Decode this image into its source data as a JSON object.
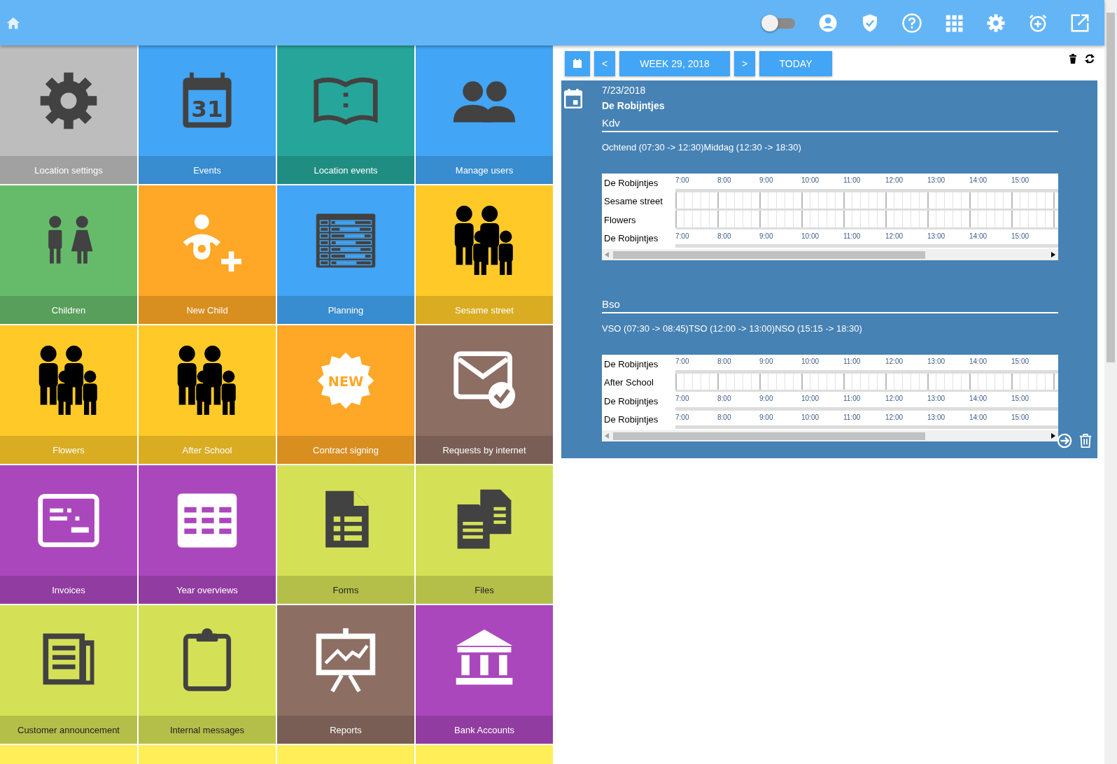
{
  "topbar": {
    "toggle": {
      "on": false
    }
  },
  "tiles": [
    {
      "label": "Location settings",
      "kind": "gear",
      "color": "#bdbdbd"
    },
    {
      "label": "Events",
      "kind": "calendar",
      "color": "#42a5f5",
      "badge": "31"
    },
    {
      "label": "Location events",
      "kind": "book",
      "color": "#26a69a"
    },
    {
      "label": "Manage users",
      "kind": "users",
      "color": "#42a5f5"
    },
    {
      "label": "Children",
      "kind": "children",
      "color": "#66bb6a"
    },
    {
      "label": "New Child",
      "kind": "baby",
      "color": "#ffa726"
    },
    {
      "label": "Planning",
      "kind": "planning",
      "color": "#42a5f5"
    },
    {
      "label": "Sesame street",
      "kind": "family",
      "color": "#ffca28"
    },
    {
      "label": "Flowers",
      "kind": "family",
      "color": "#ffca28"
    },
    {
      "label": "After School",
      "kind": "family",
      "color": "#ffca28"
    },
    {
      "label": "Contract signing",
      "kind": "new",
      "color": "#ffa726",
      "badge": "NEW"
    },
    {
      "label": "Requests by internet",
      "kind": "mail",
      "color": "#8d6e63"
    },
    {
      "label": "Invoices",
      "kind": "invoice",
      "color": "#ab47bc"
    },
    {
      "label": "Year overviews",
      "kind": "year",
      "color": "#ab47bc"
    },
    {
      "label": "Forms",
      "kind": "form",
      "color": "#d4e157"
    },
    {
      "label": "Files",
      "kind": "files",
      "color": "#d4e157"
    },
    {
      "label": "Customer announcement",
      "kind": "news",
      "color": "#d4e157"
    },
    {
      "label": "Internal messages",
      "kind": "clipboard",
      "color": "#d4e157"
    },
    {
      "label": "Reports",
      "kind": "chart",
      "color": "#8d6e63"
    },
    {
      "label": "Bank Accounts",
      "kind": "bank",
      "color": "#ab47bc"
    },
    {
      "kind": "blank",
      "color": "#ffee58"
    },
    {
      "kind": "blank",
      "color": "#ffee58"
    },
    {
      "kind": "blank",
      "color": "#ffee58"
    },
    {
      "kind": "blank",
      "color": "#ffee58"
    }
  ],
  "toolbar": {
    "week": "WEEK 29, 2018",
    "prev": "<",
    "next": ">",
    "today": "TODAY"
  },
  "day": {
    "date": "7/23/2018",
    "location": "De Robijntjes",
    "sections": [
      {
        "title": "Kdv",
        "shifts": "Ochtend (07:30 -> 12:30)Middag (12:30 -> 18:30)",
        "rows": [
          {
            "label": "De Robijntjes",
            "kind": "scale",
            "ticks": [
              "7:00",
              "8:00",
              "9:00",
              "10:00",
              "11:00",
              "12:00",
              "13:00",
              "14:00",
              "15:00"
            ]
          },
          {
            "label": "Sesame street",
            "kind": "lane"
          },
          {
            "label": "Flowers",
            "kind": "lane"
          },
          {
            "label": "De Robijntjes",
            "kind": "scale",
            "ticks": [
              "7:00",
              "8:00",
              "9:00",
              "10:00",
              "11:00",
              "12:00",
              "13:00",
              "14:00",
              "15:00"
            ]
          }
        ]
      },
      {
        "title": "Bso",
        "shifts": "VSO (07:30 -> 08:45)TSO (12:00 -> 13:00)NSO (15:15 -> 18:30)",
        "rows": [
          {
            "label": "De Robijntjes",
            "kind": "scale",
            "ticks": [
              "7:00",
              "8:00",
              "9:00",
              "10:00",
              "11:00",
              "12:00",
              "13:00",
              "14:00",
              "15:00"
            ]
          },
          {
            "label": "After School",
            "kind": "lane"
          },
          {
            "label": "De Robijntjes",
            "kind": "scale",
            "ticks": [
              "7:00",
              "8:00",
              "9:00",
              "10:00",
              "11:00",
              "12:00",
              "13:00",
              "14:00",
              "15:00"
            ]
          },
          {
            "label": "De Robijntjes",
            "kind": "scale",
            "ticks": [
              "7:00",
              "8:00",
              "9:00",
              "10:00",
              "11:00",
              "12:00",
              "13:00",
              "14:00",
              "15:00"
            ]
          }
        ]
      }
    ]
  }
}
